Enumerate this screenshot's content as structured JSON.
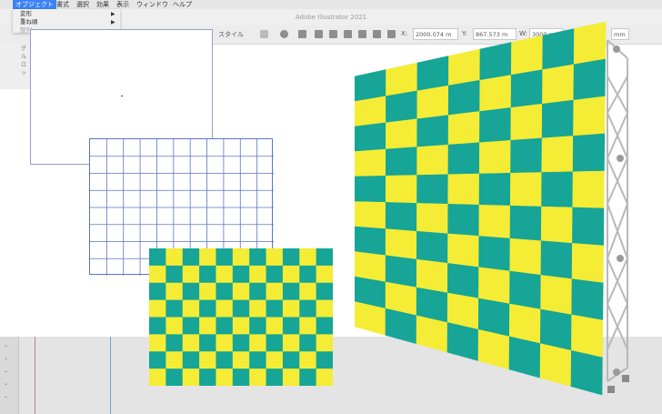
{
  "menubar": {
    "items": [
      "オブジェクト",
      "書式",
      "選択",
      "効果",
      "表示",
      "ウィンドウ",
      "ヘルプ"
    ]
  },
  "document": {
    "title": "Adobe Illustrator 2021"
  },
  "dropdown": {
    "items": [
      {
        "label": "変形",
        "submenu": true
      },
      {
        "label": "重ね順",
        "submenu": true
      },
      {
        "label": "整列",
        "submenu": false
      }
    ]
  },
  "left_panel": {
    "labels": [
      "グル",
      "ロッ"
    ]
  },
  "control_bar": {
    "style_label": "スタイル",
    "x_label": "X:",
    "x_value": "2000.074 m",
    "y_label": "Y:",
    "y_value": "867.573 m",
    "w_label": "W:",
    "w_value": "3000 mm",
    "h_value": "mm"
  },
  "checker": {
    "color_a": "#16a596",
    "color_b": "#f5ec36"
  },
  "grid_line_color": "#5a76c0",
  "frame_color": "#b8b8b8"
}
